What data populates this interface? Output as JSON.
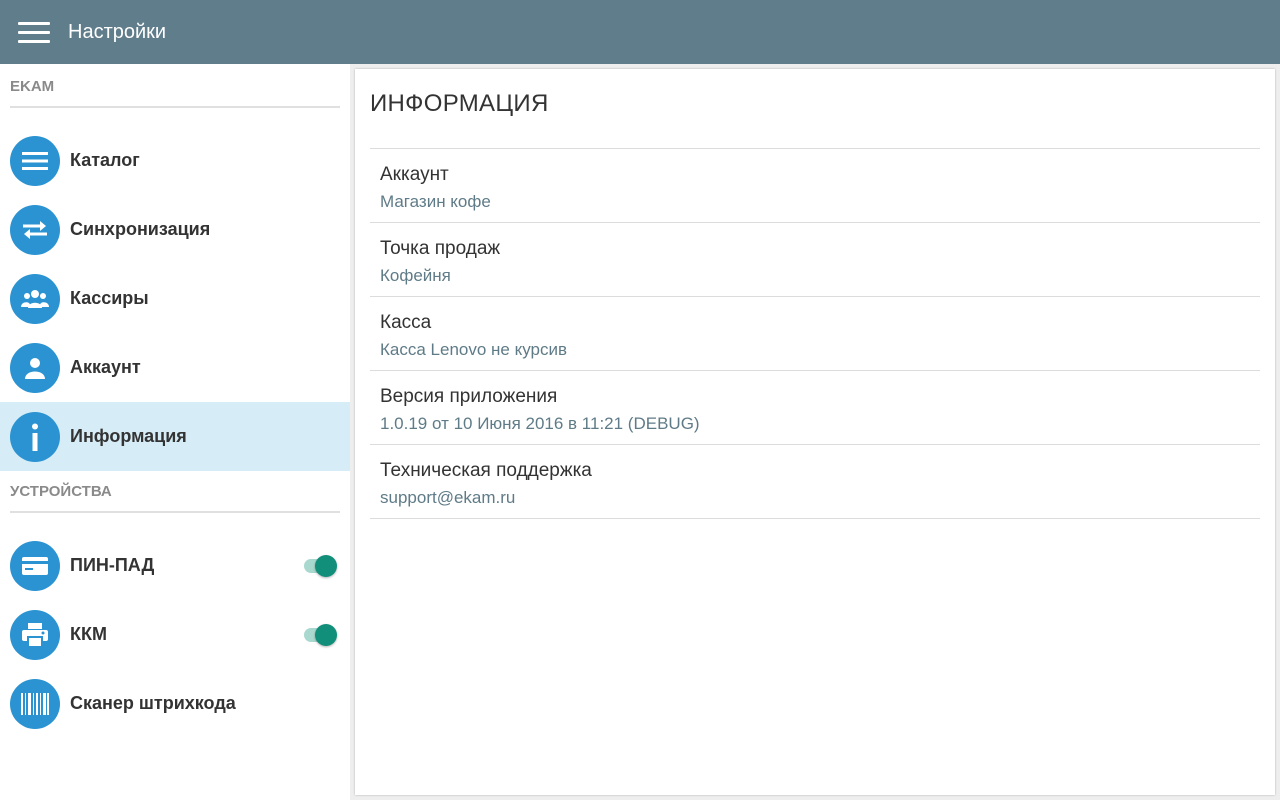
{
  "appbar": {
    "title": "Настройки"
  },
  "sidebar": {
    "section_ekam": "EKAM",
    "section_devices": "УСТРОЙСТВА",
    "items": [
      {
        "label": "Каталог",
        "icon": "list-icon"
      },
      {
        "label": "Синхронизация",
        "icon": "sync-arrows-icon"
      },
      {
        "label": "Кассиры",
        "icon": "group-icon"
      },
      {
        "label": "Аккаунт",
        "icon": "person-icon"
      },
      {
        "label": "Информация",
        "icon": "info-icon",
        "active": true
      }
    ],
    "devices": [
      {
        "label": "ПИН-ПАД",
        "icon": "card-icon",
        "toggle": true
      },
      {
        "label": "ККМ",
        "icon": "printer-icon",
        "toggle": true
      },
      {
        "label": "Сканер штрихкода",
        "icon": "barcode-icon"
      }
    ]
  },
  "main": {
    "title": "ИНФОРМАЦИЯ",
    "rows": [
      {
        "label": "Аккаунт",
        "value": "Магазин кофе"
      },
      {
        "label": "Точка продаж",
        "value": "Кофейня"
      },
      {
        "label": "Касса",
        "value": "Касса Lenovo не курсив"
      },
      {
        "label": "Версия приложения",
        "value": "1.0.19 от 10 Июня 2016 в 11:21 (DEBUG)"
      },
      {
        "label": "Техническая поддержка",
        "value": "support@ekam.ru"
      }
    ]
  },
  "colors": {
    "appbar": "#607d8b",
    "icon_circle": "#2b93d1",
    "active_item": "#d6edf7",
    "toggle_on": "#118f7a",
    "value_text": "#5f7b87"
  }
}
